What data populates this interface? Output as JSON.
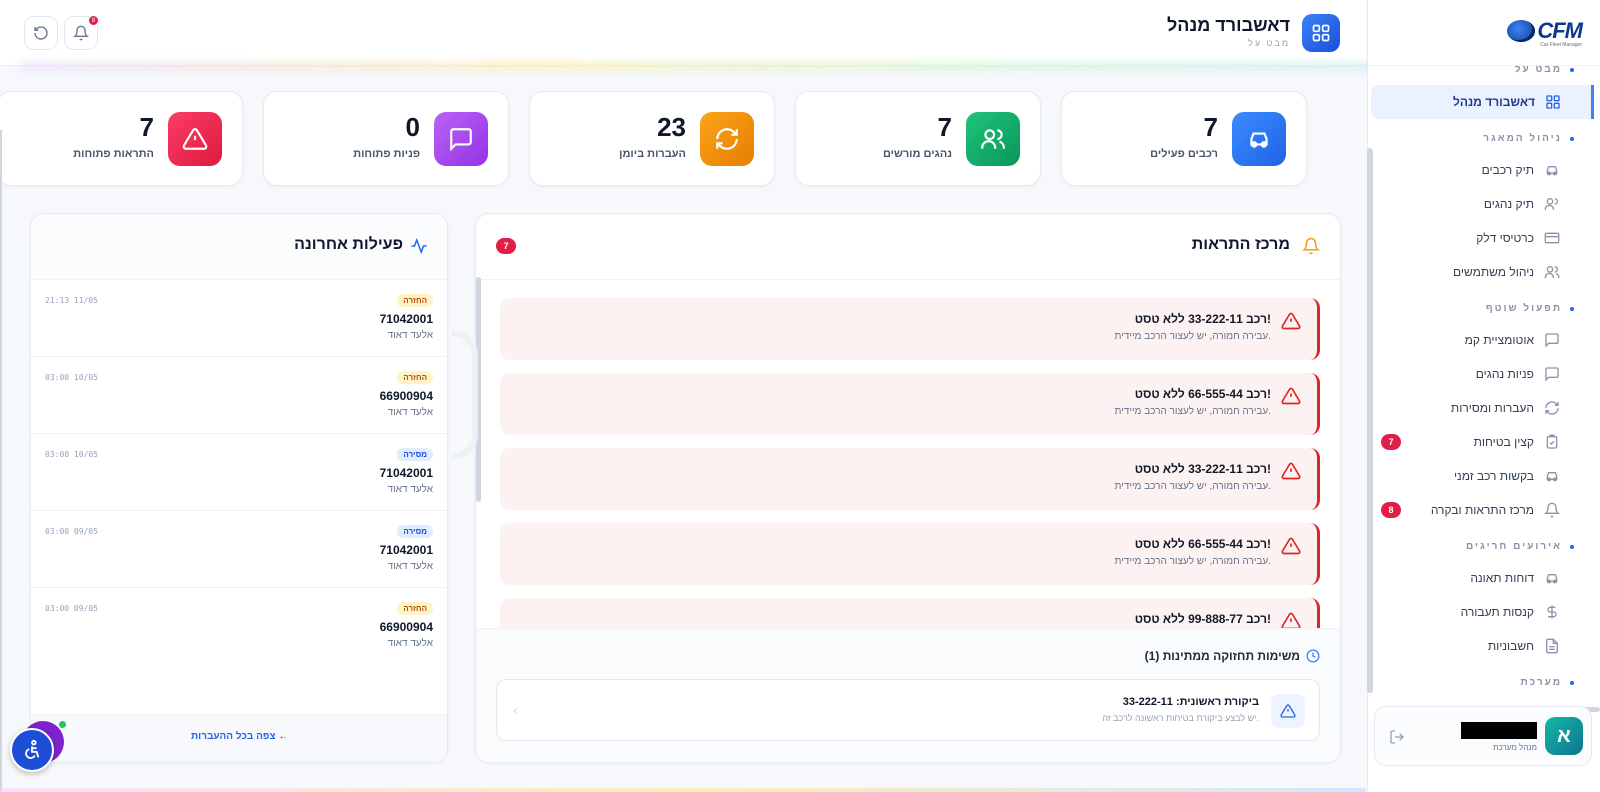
{
  "app": {
    "logo_text": "CFM",
    "logo_tag": "Car Fleet Manager"
  },
  "topbar": {
    "title": "דאשבורד מנהל",
    "subtitle": "מבט על",
    "bell_badge": "8",
    "icons": {
      "page": "dashboard-grid-icon",
      "bell": "bell-icon",
      "refresh": "refresh-icon"
    }
  },
  "sidebar": {
    "sections": [
      {
        "label": "מבט על"
      },
      {
        "label": "ניהול המאגר"
      },
      {
        "label": "תפעול שוטף"
      },
      {
        "label": "אירועים חריגים"
      },
      {
        "label": "מערכת"
      }
    ],
    "items": [
      {
        "label": "דאשבורד מנהל",
        "icon": "dashboard-grid-icon",
        "active": true
      },
      {
        "label": "תיק רכבים",
        "icon": "car-icon"
      },
      {
        "label": "תיק נהגים",
        "icon": "users-icon"
      },
      {
        "label": "כרטיסי דלק",
        "icon": "credit-card-icon"
      },
      {
        "label": "ניהול משתמשים",
        "icon": "user-cog-icon"
      },
      {
        "label": "אוטומציית קמ",
        "icon": "message-square-icon"
      },
      {
        "label": "פניות נהגים",
        "icon": "message-square-icon"
      },
      {
        "label": "העברות ומסירות",
        "icon": "refresh-icon"
      },
      {
        "label": "קצין בטיחות",
        "icon": "clipboard-check-icon",
        "badge": "7"
      },
      {
        "label": "בקשות רכב זמני",
        "icon": "car-icon"
      },
      {
        "label": "מרכז התראות ובקרה",
        "icon": "bell-icon",
        "badge": "8"
      },
      {
        "label": "דוחות תאונה",
        "icon": "car-crash-icon"
      },
      {
        "label": "קנסות תעבורה",
        "icon": "dollar-icon"
      },
      {
        "label": "חשבוניות",
        "icon": "file-text-icon"
      }
    ],
    "user": {
      "initial": "א",
      "name": "",
      "role": "מנהל מערכת"
    }
  },
  "stats": [
    {
      "value": "7",
      "label": "רכבים פעילים",
      "icon": "car-icon",
      "color": "#2f7bf5"
    },
    {
      "value": "7",
      "label": "נהגים מורשים",
      "icon": "users-icon",
      "color": "#10b068"
    },
    {
      "value": "23",
      "label": "העברות ביומן",
      "icon": "refresh-icon",
      "color": "#f29009"
    },
    {
      "value": "0",
      "label": "פניות פתוחות",
      "icon": "message-square-icon",
      "color": "#a54ee8"
    },
    {
      "value": "7",
      "label": "התראות פתוחות",
      "icon": "alert-triangle-icon",
      "color": "#ef2e55"
    }
  ],
  "alerts": {
    "title": "מרכז התראות",
    "count": "7",
    "items": [
      {
        "title": "רכב 33-222-11 ללא טסט!",
        "desc": "עבירה חמורה, יש לעצור הרכב מיידית."
      },
      {
        "title": "רכב 66-555-44 ללא טסט!",
        "desc": "עבירה חמורה, יש לעצור הרכב מיידית."
      },
      {
        "title": "רכב 33-222-11 ללא טסט!",
        "desc": "עבירה חמורה, יש לעצור הרכב מיידית."
      },
      {
        "title": "רכב 66-555-44 ללא טסט!",
        "desc": "עבירה חמורה, יש לעצור הרכב מיידית."
      },
      {
        "title": "רכב 99-888-77 ללא טסט!",
        "desc": ""
      }
    ]
  },
  "maintenance": {
    "title": "משימות תחזוקה ממתינות (1)",
    "task": {
      "name": "ביקורת ראשונית: 33-222-11",
      "desc": "יש לבצע ביקורת בטיחות ראשונה לרכב זה."
    }
  },
  "activity": {
    "title": "פעילות אחרונה",
    "rows": [
      {
        "badge": "החזרה",
        "type": "return",
        "number": "71042001",
        "person": "אלעד דאוד",
        "time": "21:13 11/05"
      },
      {
        "badge": "החזרה",
        "type": "return",
        "number": "66900904",
        "person": "אלעד דאוד",
        "time": "03:00 10/05"
      },
      {
        "badge": "מסירה",
        "type": "deliver",
        "number": "71042001",
        "person": "אלעד דאוד",
        "time": "03:00 10/05"
      },
      {
        "badge": "מסירה",
        "type": "deliver",
        "number": "71042001",
        "person": "אלעד דאוד",
        "time": "03:00 09/05"
      },
      {
        "badge": "החזרה",
        "type": "return",
        "number": "66900904",
        "person": "אלעד דאוד",
        "time": "03:00 09/05"
      }
    ],
    "view_all": "צפה בכל ההעברות ←"
  }
}
